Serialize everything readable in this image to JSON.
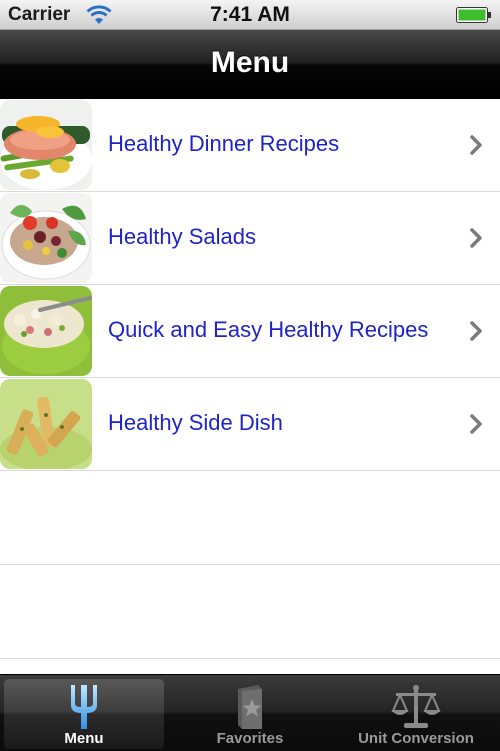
{
  "status_bar": {
    "carrier": "Carrier",
    "time": "7:41 AM",
    "icons": [
      "wifi-icon",
      "battery-icon"
    ]
  },
  "nav": {
    "title": "Menu"
  },
  "menu_items": [
    {
      "label": "Healthy Dinner Recipes",
      "thumbnail": "salmon-dish"
    },
    {
      "label": "Healthy Salads",
      "thumbnail": "salad-dish"
    },
    {
      "label": "Quick and Easy Healthy Recipes",
      "thumbnail": "potato-salad-bowl"
    },
    {
      "label": "Healthy Side Dish",
      "thumbnail": "bread-sticks"
    }
  ],
  "tab_bar": {
    "tabs": [
      {
        "label": "Menu",
        "icon": "fork-icon",
        "selected": true
      },
      {
        "label": "Favorites",
        "icon": "star-book-icon",
        "selected": false
      },
      {
        "label": "Unit Conversion",
        "icon": "scale-icon",
        "selected": false
      }
    ]
  },
  "colors": {
    "link_text": "#1e24c8",
    "selected_icon": "#3aa0f0",
    "nav_bar": "#000000"
  }
}
